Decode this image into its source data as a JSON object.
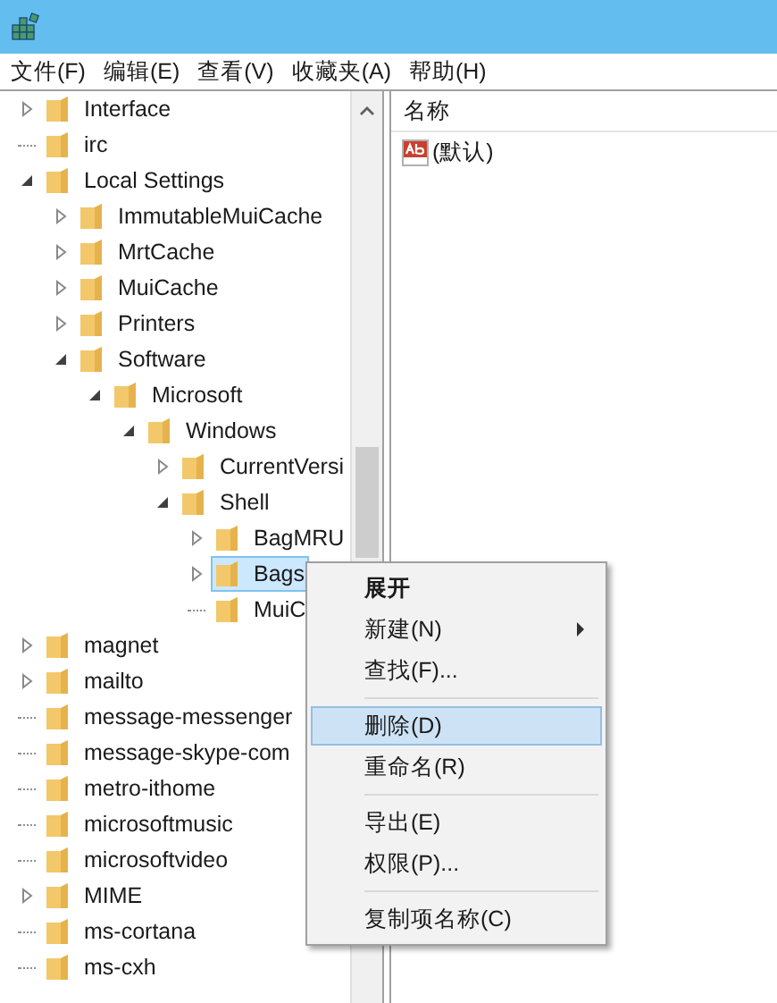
{
  "menu_bar": [
    "文件(F)",
    "编辑(E)",
    "查看(V)",
    "收藏夹(A)",
    "帮助(H)"
  ],
  "tree": [
    {
      "label": "Interface",
      "kind": "collapsed",
      "selected": false
    },
    {
      "label": "irc",
      "kind": "leaf",
      "selected": false
    },
    {
      "label": "Local Settings",
      "kind": "expanded",
      "selected": false,
      "children": [
        {
          "label": "ImmutableMuiCache",
          "kind": "collapsed",
          "selected": false
        },
        {
          "label": "MrtCache",
          "kind": "collapsed",
          "selected": false
        },
        {
          "label": "MuiCache",
          "kind": "collapsed",
          "selected": false
        },
        {
          "label": "Printers",
          "kind": "collapsed",
          "selected": false
        },
        {
          "label": "Software",
          "kind": "expanded",
          "selected": false,
          "children": [
            {
              "label": "Microsoft",
              "kind": "expanded",
              "selected": false,
              "children": [
                {
                  "label": "Windows",
                  "kind": "expanded",
                  "selected": false,
                  "children": [
                    {
                      "label": "CurrentVersi",
                      "kind": "collapsed",
                      "selected": false
                    },
                    {
                      "label": "Shell",
                      "kind": "expanded",
                      "selected": false,
                      "children": [
                        {
                          "label": "BagMRU",
                          "kind": "collapsed",
                          "selected": false
                        },
                        {
                          "label": "Bags",
                          "kind": "collapsed",
                          "selected": true
                        },
                        {
                          "label": "MuiC",
                          "kind": "leaf",
                          "selected": false
                        }
                      ]
                    }
                  ]
                }
              ]
            }
          ]
        }
      ]
    },
    {
      "label": "magnet",
      "kind": "collapsed",
      "selected": false
    },
    {
      "label": "mailto",
      "kind": "collapsed",
      "selected": false
    },
    {
      "label": "message-messenger",
      "kind": "leaf",
      "selected": false
    },
    {
      "label": "message-skype-com",
      "kind": "leaf",
      "selected": false
    },
    {
      "label": "metro-ithome",
      "kind": "leaf",
      "selected": false
    },
    {
      "label": "microsoftmusic",
      "kind": "leaf",
      "selected": false
    },
    {
      "label": "microsoftvideo",
      "kind": "leaf",
      "selected": false
    },
    {
      "label": "MIME",
      "kind": "collapsed",
      "selected": false
    },
    {
      "label": "ms-cortana",
      "kind": "leaf",
      "selected": false
    },
    {
      "label": "ms-cxh",
      "kind": "leaf",
      "selected": false
    }
  ],
  "values": {
    "columns": [
      "名称"
    ],
    "rows": [
      {
        "name": "(默认)"
      }
    ]
  },
  "context_menu": [
    {
      "kind": "item",
      "label": "展开",
      "default": true,
      "submenu": false,
      "selected": false
    },
    {
      "kind": "item",
      "label": "新建(N)",
      "default": false,
      "submenu": true,
      "selected": false
    },
    {
      "kind": "item",
      "label": "查找(F)...",
      "default": false,
      "submenu": false,
      "selected": false
    },
    {
      "kind": "separator"
    },
    {
      "kind": "item",
      "label": "删除(D)",
      "default": false,
      "submenu": false,
      "selected": true
    },
    {
      "kind": "item",
      "label": "重命名(R)",
      "default": false,
      "submenu": false,
      "selected": false
    },
    {
      "kind": "separator"
    },
    {
      "kind": "item",
      "label": "导出(E)",
      "default": false,
      "submenu": false,
      "selected": false
    },
    {
      "kind": "item",
      "label": "权限(P)...",
      "default": false,
      "submenu": false,
      "selected": false
    },
    {
      "kind": "separator"
    },
    {
      "kind": "item",
      "label": "复制项名称(C)",
      "default": false,
      "submenu": false,
      "selected": false
    }
  ]
}
